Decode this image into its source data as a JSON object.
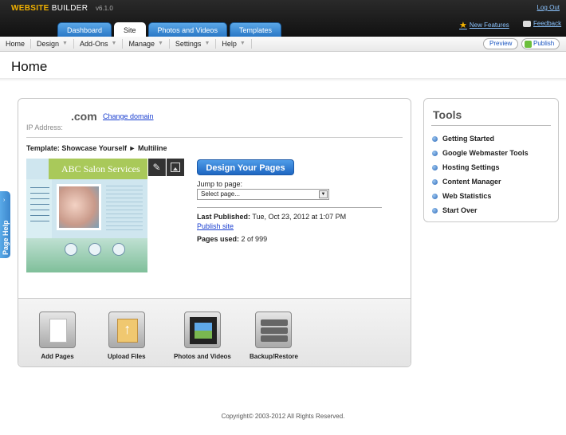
{
  "header": {
    "brand_part1": "WEBSITE",
    "brand_part2": "BUILDER",
    "version": "v6.1.0",
    "logout": "Log Out",
    "new_features": "New Features",
    "feedback": "Feedback"
  },
  "tabs": [
    {
      "label": "Dashboard"
    },
    {
      "label": "Site"
    },
    {
      "label": "Photos and Videos"
    },
    {
      "label": "Templates"
    }
  ],
  "menu": [
    {
      "label": "Home"
    },
    {
      "label": "Design"
    },
    {
      "label": "Add-Ons"
    },
    {
      "label": "Manage"
    },
    {
      "label": "Settings"
    },
    {
      "label": "Help"
    }
  ],
  "toolbar": {
    "preview": "Preview",
    "publish": "Publish"
  },
  "page": {
    "title": "Home",
    "help_tab": "Page Help"
  },
  "site": {
    "domain": ".com",
    "change_domain": "Change domain",
    "ip_label": "IP Address:",
    "template": "Template: Showcase Yourself ► Multiline",
    "thumb_title": "ABC Salon Services",
    "design_button": "Design Your Pages",
    "jump_label": "Jump to page:",
    "jump_placeholder": "Select page...",
    "last_published_label": "Last Published:",
    "last_published_value": "Tue, Oct 23, 2012 at 1:07 PM",
    "publish_site": "Publish site",
    "pages_used_label": "Pages used:",
    "pages_used_value": "2 of  999"
  },
  "quick_tools": [
    {
      "label": "Add Pages"
    },
    {
      "label": "Upload Files"
    },
    {
      "label": "Photos and Videos"
    },
    {
      "label": "Backup/Restore"
    }
  ],
  "tools": {
    "title": "Tools",
    "items": [
      {
        "label": "Getting Started"
      },
      {
        "label": "Google Webmaster Tools"
      },
      {
        "label": "Hosting Settings"
      },
      {
        "label": "Content Manager"
      },
      {
        "label": "Web Statistics"
      },
      {
        "label": "Start Over"
      }
    ]
  },
  "footer": "Copyright© 2003-2012 All Rights Reserved."
}
